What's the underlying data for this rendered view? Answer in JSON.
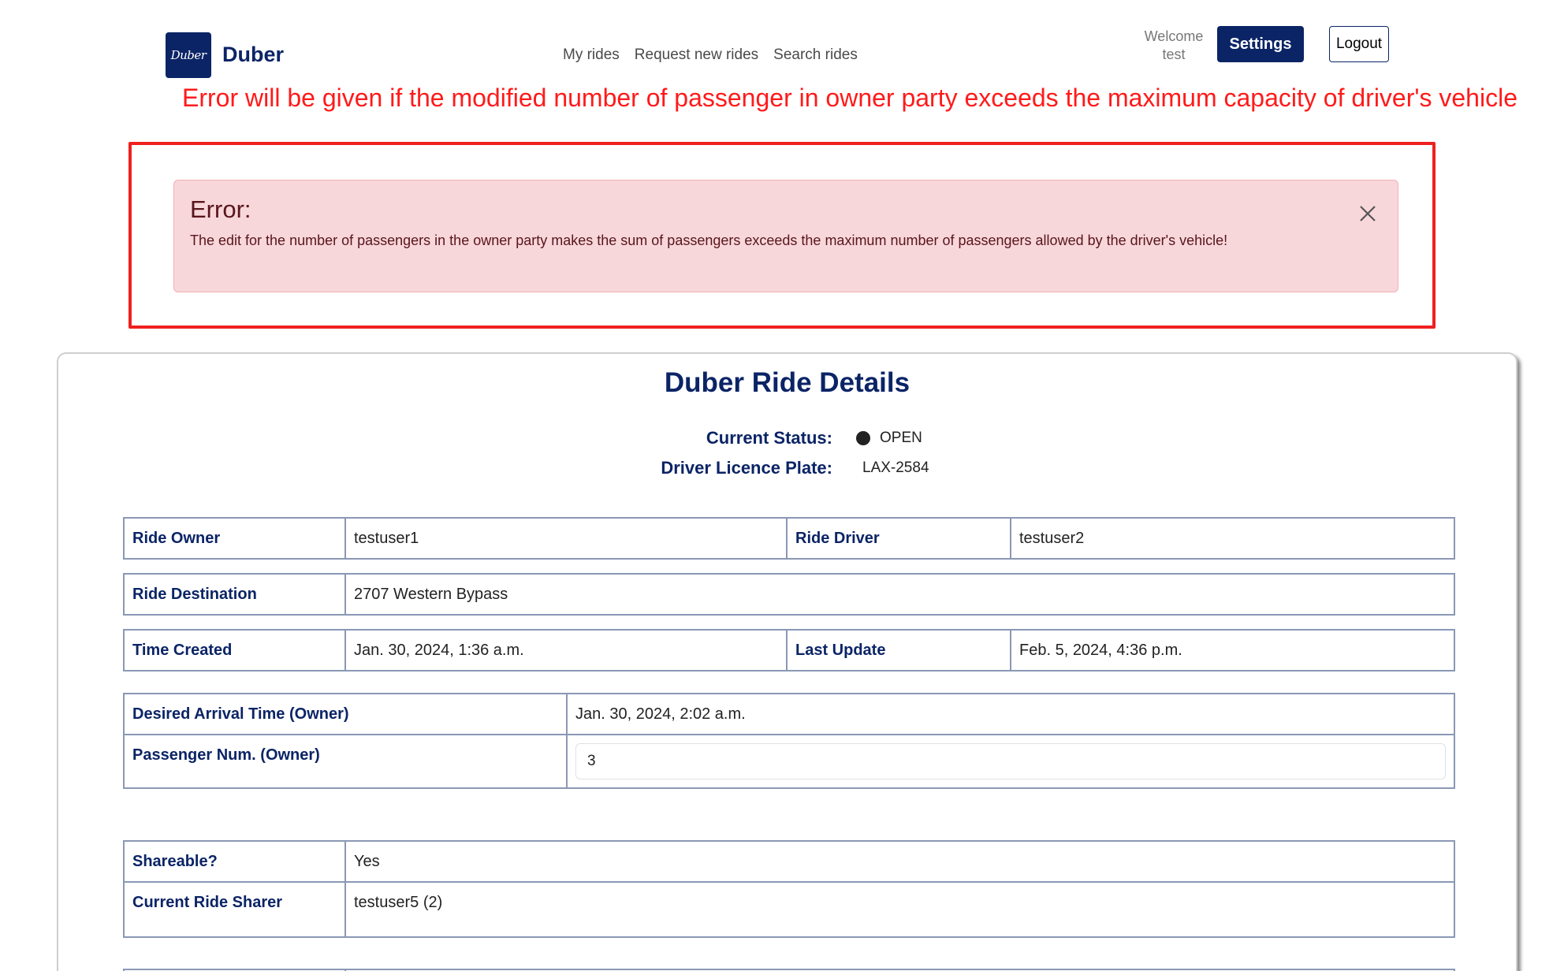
{
  "header": {
    "logo_text": "Duber",
    "brand": "Duber",
    "nav": [
      "My rides",
      "Request new rides",
      "Search rides"
    ],
    "welcome": "Welcome",
    "username": "test",
    "settings_label": "Settings",
    "logout_label": "Logout"
  },
  "annotation": "Error will be given if the modified number of passenger in owner party exceeds the maximum capacity of driver's vehicle",
  "alert": {
    "title": "Error:",
    "message": "The edit for the number of passengers in the owner party makes the sum of passengers exceeds the maximum number of passengers allowed by the driver's vehicle!"
  },
  "details": {
    "title": "Duber Ride Details",
    "status_label": "Current Status:",
    "status_value": "OPEN",
    "plate_label": "Driver Licence Plate:",
    "plate_value": "LAX-2584"
  },
  "rows": {
    "owner_label": "Ride Owner",
    "owner_value": "testuser1",
    "driver_label": "Ride Driver",
    "driver_value": "testuser2",
    "dest_label": "Ride Destination",
    "dest_value": "2707 Western Bypass",
    "created_label": "Time Created",
    "created_value": "Jan. 30, 2024, 1:36 a.m.",
    "updated_label": "Last Update",
    "updated_value": "Feb. 5, 2024, 4:36 p.m.",
    "arrival_label": "Desired Arrival Time (Owner)",
    "arrival_value": "Jan. 30, 2024, 2:02 a.m.",
    "passenger_label": "Passenger Num. (Owner)",
    "passenger_value": "3",
    "shareable_label": "Shareable?",
    "shareable_value": "Yes",
    "sharer_label": "Current Ride Sharer",
    "sharer_value": "testuser5 (2)"
  },
  "colors": {
    "brand_navy": "#0b2466",
    "annotation_red": "#ff1a1a",
    "alert_bg": "#f8d7da",
    "alert_text": "#58151c",
    "table_border": "#8a98b5"
  }
}
